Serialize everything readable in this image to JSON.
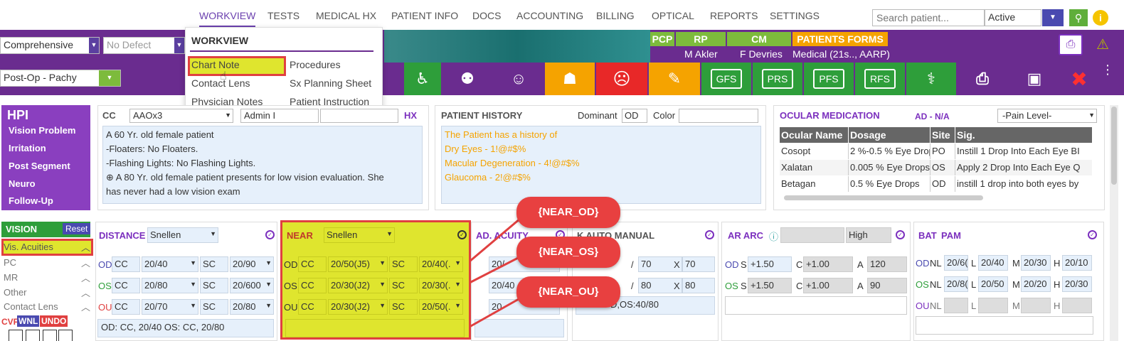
{
  "nav": {
    "tabs": [
      "WORKVIEW",
      "TESTS",
      "MEDICAL HX",
      "PATIENT INFO",
      "DOCS",
      "ACCOUNTING",
      "BILLING",
      "OPTICAL",
      "REPORTS",
      "SETTINGS"
    ],
    "search_placeholder": "Search patient...",
    "status_value": "Active"
  },
  "topbar": {
    "exam_type": "Comprehensive",
    "defect": "No Defect",
    "template": "Post-Op - Pachy",
    "pcp_label": "PCP",
    "rp_label": "RP",
    "cm_label": "CM",
    "forms_label": "PATIENTS FORMS",
    "rp_name": "M Akler",
    "cm_name": "F Devries",
    "forms_value": "Medical (21s.., AARP)"
  },
  "toolbar_buttons": [
    "GFS",
    "PRS",
    "PFS",
    "RFS"
  ],
  "workview_menu": {
    "title": "WORKVIEW",
    "items": [
      "Chart Note",
      "Procedures",
      "Contact Lens",
      "Sx Planning Sheet",
      "Physician Notes",
      "Patient Instruction"
    ]
  },
  "hpi": {
    "title": "HPI",
    "items": [
      "Vision Problem",
      "Irritation",
      "Post Segment",
      "Neuro",
      "Follow-Up"
    ]
  },
  "cc": {
    "label": "CC",
    "value": "AAOx3",
    "provider": "Admin  I",
    "hx_label": "HX",
    "lines": [
      "A 60 Yr. old female patient",
      "-Floaters: No Floaters.",
      "-Flashing Lights: No Flashing Lights.",
      "⊕ A 80 Yr. old female patient presents for low vision evaluation. She",
      "has never had a low vision exam"
    ]
  },
  "history": {
    "title": "PATIENT HISTORY",
    "dominant_label": "Dominant",
    "dominant_value": "OD",
    "color_label": "Color",
    "lines": [
      "The Patient has a history of",
      "Dry Eyes - 1!@#$%",
      "Macular Degeneration - 4!@#$%",
      "Glaucoma - 2!@#$%"
    ]
  },
  "ocular_med": {
    "title": "OCULAR MEDICATION",
    "ad": "AD - N/A",
    "pain": "-Pain Level-",
    "headers": [
      "Ocular Name",
      "Dosage",
      "Site",
      "Sig."
    ],
    "rows": [
      [
        "Cosopt",
        "2 %-0.5 % Eye Drops",
        "PO",
        "Instill 1 Drop Into Each Eye BI"
      ],
      [
        "Xalatan",
        "0.005 % Eye Drops",
        "OS",
        "Apply 2 Drop Into Each Eye Q"
      ],
      [
        "Betagan",
        "0.5 % Eye Drops",
        "OD",
        "instill 1 drop into both eyes by"
      ]
    ]
  },
  "vision_nav": {
    "title": "VISION",
    "reset": "Reset",
    "items": [
      "Vis. Acuities",
      "PC",
      "MR",
      "Other",
      "Contact Lens"
    ],
    "cvf": "CVF",
    "wnl": "WNL",
    "undo": "UNDO"
  },
  "distance": {
    "title": "DISTANCE",
    "chart": "Snellen",
    "rows": [
      {
        "eye": "OD",
        "c1": "CC",
        "v1": "20/40",
        "c2": "SC",
        "v2": "20/90"
      },
      {
        "eye": "OS",
        "c1": "CC",
        "v1": "20/80",
        "c2": "SC",
        "v2": "20/600"
      },
      {
        "eye": "OU",
        "c1": "CC",
        "v1": "20/70",
        "c2": "SC",
        "v2": "20/80"
      }
    ],
    "summary": "OD: CC, 20/40 OS: CC, 20/80"
  },
  "near": {
    "title": "NEAR",
    "chart": "Snellen",
    "rows": [
      {
        "eye": "OD",
        "c1": "CC",
        "v1": "20/50(J5)",
        "c2": "SC",
        "v2": "20/40(."
      },
      {
        "eye": "OS",
        "c1": "CC",
        "v1": "20/30(J2)",
        "c2": "SC",
        "v2": "20/30(."
      },
      {
        "eye": "OU",
        "c1": "CC",
        "v1": "20/30(J2)",
        "c2": "SC",
        "v2": "20/50(."
      }
    ]
  },
  "ad_acuity": {
    "title": "AD. ACUITY",
    "rows": [
      "20/",
      "20/40",
      "20"
    ]
  },
  "k_auto": {
    "title": "K AUTO MANUAL",
    "rows": [
      [
        "70",
        "70"
      ],
      [
        "80",
        "80"
      ]
    ],
    "summary": "D,OS:40/80"
  },
  "ar_arc": {
    "title": "AR ARC",
    "range": "High",
    "rows": [
      {
        "eye": "OD",
        "s": "+1.50",
        "c": "+1.00",
        "a": "120"
      },
      {
        "eye": "OS",
        "s": "+1.50",
        "c": "+1.00",
        "a": "90"
      }
    ]
  },
  "bat": {
    "title": "BAT",
    "pam": "PAM",
    "rows": [
      {
        "eye": "OD",
        "nl": "20/6(",
        "l": "20/40",
        "m": "20/30",
        "h": "20/10"
      },
      {
        "eye": "OS",
        "nl": "20/8(",
        "l": "20/50",
        "m": "20/20",
        "h": "20/30"
      },
      {
        "eye": "OU",
        "nl": "",
        "l": "",
        "m": "",
        "h": ""
      }
    ]
  },
  "callouts": [
    "{NEAR_OD}",
    "{NEAR_OS}",
    "{NEAR_OU}"
  ],
  "colors": {
    "purple": "#6a2c8f",
    "green": "#2e9e3a",
    "orange": "#f5a300",
    "red": "#e84040",
    "yellow": "#dfe52e"
  }
}
